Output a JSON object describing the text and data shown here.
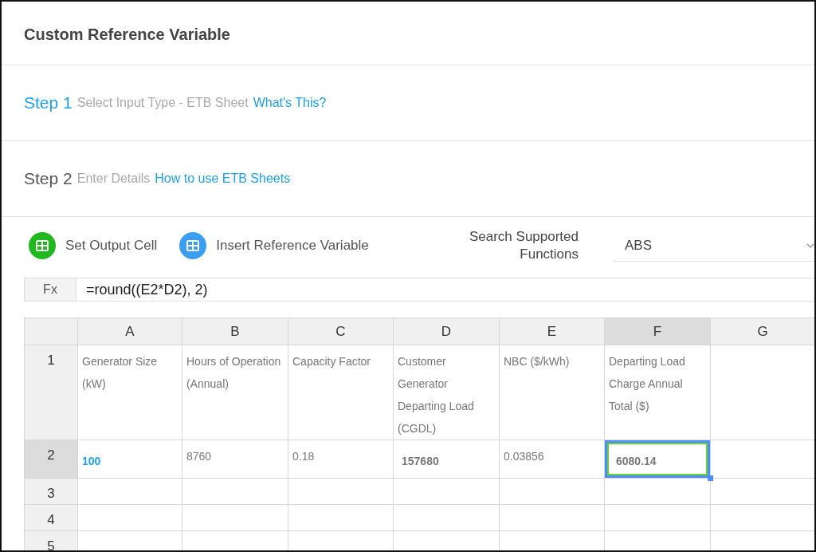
{
  "title": "Custom Reference Variable",
  "steps": [
    {
      "number": "Step 1",
      "description": "Select Input Type - ETB Sheet",
      "link": "What's This?",
      "active": true
    },
    {
      "number": "Step 2",
      "description": "Enter Details",
      "link": "How to use ETB Sheets",
      "active": false
    }
  ],
  "toolbar": {
    "buttons": [
      {
        "label": "Set Output Cell",
        "color": "#1fb81f"
      },
      {
        "label": "Insert Reference Variable",
        "color": "#3a9ff0"
      }
    ],
    "search_label": "Search Supported Functions",
    "search_value": "ABS"
  },
  "formula_bar": {
    "label": "Fx",
    "value": "=round((E2*D2), 2)"
  },
  "sheet": {
    "columns": [
      {
        "label": "A",
        "selected": false
      },
      {
        "label": "B",
        "selected": false
      },
      {
        "label": "C",
        "selected": false
      },
      {
        "label": "D",
        "selected": false
      },
      {
        "label": "E",
        "selected": false
      },
      {
        "label": "F",
        "selected": true
      },
      {
        "label": "G",
        "selected": false
      }
    ],
    "rows": [
      {
        "label": "1",
        "selected": false,
        "cells": [
          {
            "text": "Generator Size (kW)",
            "kind": "text",
            "selected": false
          },
          {
            "text": "Hours of Operation (Annual)",
            "kind": "text",
            "selected": false
          },
          {
            "text": "Capacity Factor",
            "kind": "text",
            "selected": false
          },
          {
            "text": "Customer Generator Departing Load (CGDL)",
            "kind": "text",
            "selected": false
          },
          {
            "text": "NBC ($/kWh)",
            "kind": "text",
            "selected": false
          },
          {
            "text": "Departing Load Charge Annual Total ($)",
            "kind": "text",
            "selected": false
          }
        ]
      },
      {
        "label": "2",
        "selected": true,
        "cells": [
          {
            "text": "100",
            "kind": "input",
            "selected": false
          },
          {
            "text": "8760",
            "kind": "text",
            "selected": false
          },
          {
            "text": "0.18",
            "kind": "text",
            "selected": false
          },
          {
            "text": "157680",
            "kind": "formula",
            "selected": false
          },
          {
            "text": "0.03856",
            "kind": "text",
            "selected": false
          },
          {
            "text": "6080.14",
            "kind": "formula",
            "selected": true
          }
        ]
      },
      {
        "label": "3",
        "selected": false,
        "cells": []
      },
      {
        "label": "4",
        "selected": false,
        "cells": []
      },
      {
        "label": "5",
        "selected": false,
        "cells": []
      }
    ]
  }
}
